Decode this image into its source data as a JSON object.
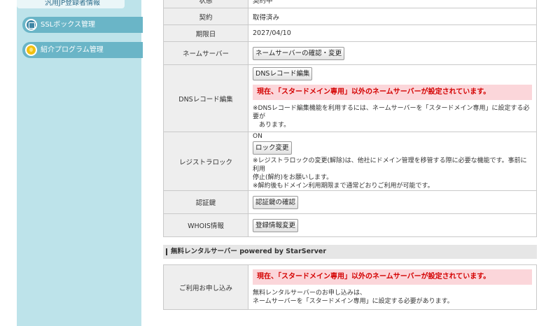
{
  "sidebar": {
    "top_link": "汎用JP登録者情報",
    "items": [
      {
        "label": "SSLボックス管理",
        "icon": "ssl-box-icon"
      },
      {
        "label": "紹介プログラム管理",
        "icon": "referral-icon"
      }
    ]
  },
  "domain_table": {
    "partial_top": {
      "label": "状態",
      "value": "契約中"
    },
    "contract": {
      "label": "契約",
      "value": "取得済み"
    },
    "expiry": {
      "label": "期限日",
      "value": "2027/04/10"
    },
    "nameserver": {
      "label": "ネームサーバー",
      "button": "ネームサーバーの確認・変更"
    },
    "dns": {
      "label": "DNSレコード編集",
      "button": "DNSレコード編集",
      "warning": "現在、「スタードメイン専用」以外のネームサーバーが設定されています。",
      "note_1": "※DNSレコード編集機能を利用するには、ネームサーバーを「スタードメイン専用」に設定する必要が",
      "note_2": "　あります。"
    },
    "registrar_lock": {
      "label": "レジストラロック",
      "status": "ON",
      "button": "ロック変更",
      "note_1": "※レジストラロックの変更(解除)は、他社にドメイン管理を移管する際に必要な機能です。事前に利用",
      "note_2": "停止(解約)をお願いします。",
      "note_3": "※解約後もドメイン利用期限まで通常どおりご利用が可能です。"
    },
    "auth_key": {
      "label": "認証鍵",
      "button": "認証鍵の確認"
    },
    "whois": {
      "label": "WHOIS情報",
      "button": "登録情報変更"
    }
  },
  "rental_section": {
    "heading": "無料レンタルサーバー powered by StarServer",
    "label": "ご利用お申し込み",
    "warning": "現在、「スタードメイン専用」以外のネームサーバーが設定されています。",
    "note_1": "無料レンタルサーバーのお申し込みは、",
    "note_2": "ネームサーバーを「スタードメイン専用」に設定する必要があります。"
  }
}
